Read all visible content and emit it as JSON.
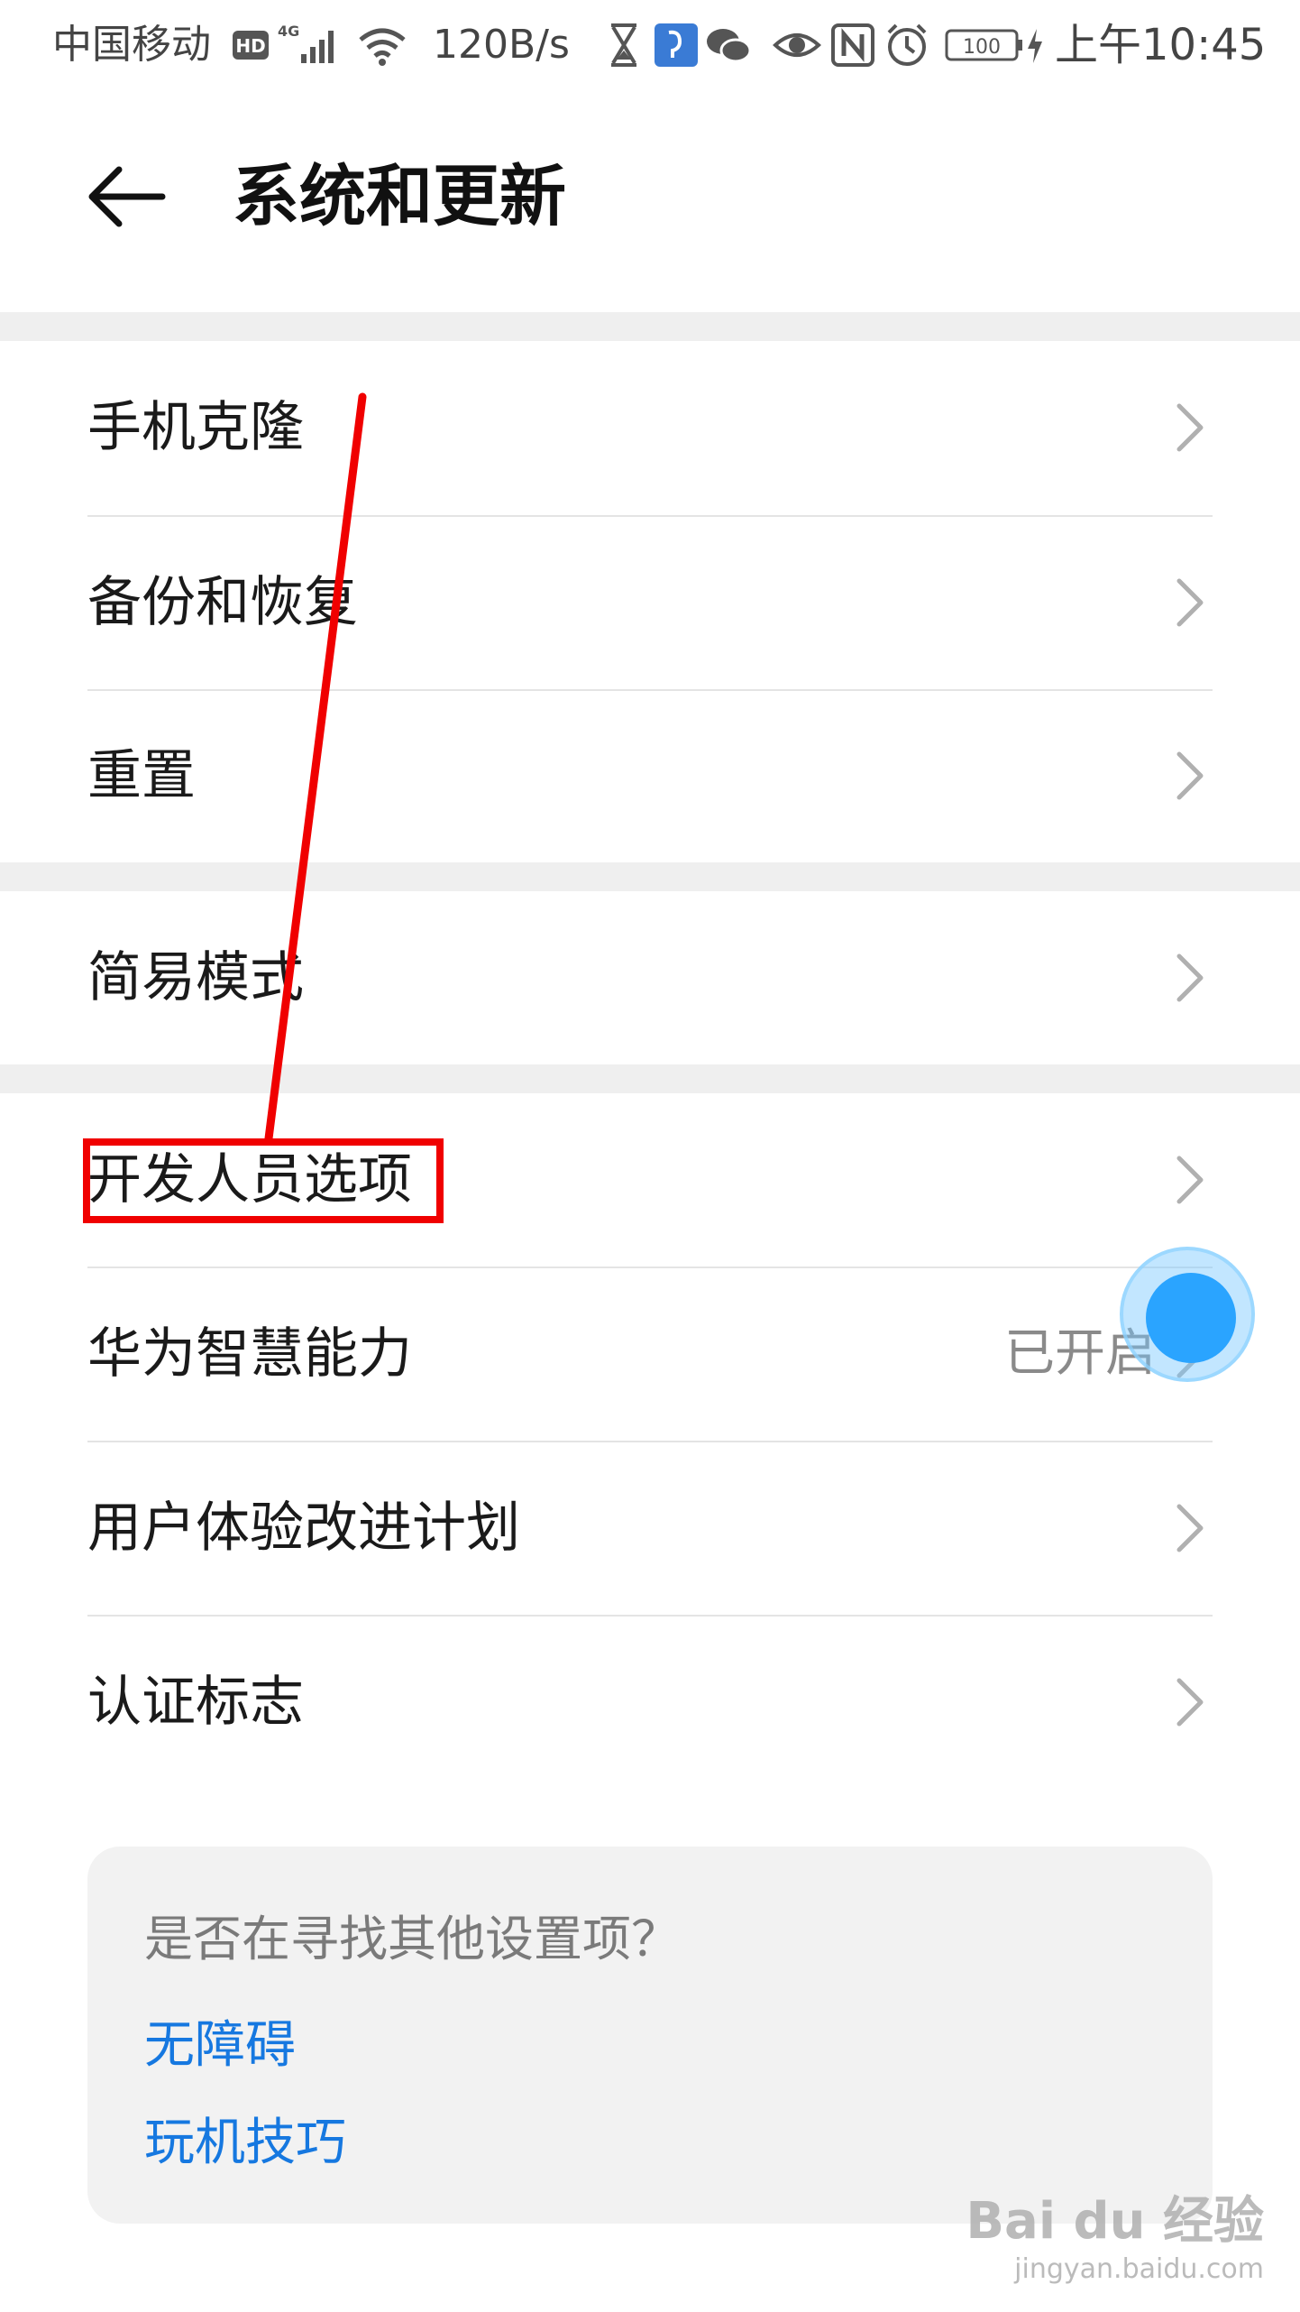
{
  "status_bar": {
    "carrier": "中国移动",
    "network_badges": [
      "HD",
      "4G"
    ],
    "speed": "120B/s",
    "battery": "100",
    "time": "上午10:45",
    "icons": [
      "signal-icon",
      "wifi-icon",
      "hourglass-icon",
      "app-notification-icon",
      "wechat-icon",
      "eye-icon",
      "nfc-icon",
      "alarm-icon",
      "battery-icon",
      "charging-icon"
    ]
  },
  "header": {
    "title": "系统和更新"
  },
  "groups": [
    {
      "items": [
        {
          "label": "手机克隆"
        },
        {
          "label": "备份和恢复"
        },
        {
          "label": "重置"
        }
      ]
    },
    {
      "items": [
        {
          "label": "简易模式"
        }
      ]
    },
    {
      "items": [
        {
          "label": "开发人员选项"
        },
        {
          "label": "华为智慧能力",
          "value": "已开启"
        },
        {
          "label": "用户体验改进计划"
        },
        {
          "label": "认证标志"
        }
      ]
    }
  ],
  "suggestions": {
    "title": "是否在寻找其他设置项？",
    "links": [
      "无障碍",
      "玩机技巧"
    ]
  },
  "watermark": {
    "logo": "Bai du 经验",
    "url": "jingyan.baidu.com"
  },
  "annotation": {
    "color": "#f00000",
    "highlighted_item": "开发人员选项"
  },
  "colors": {
    "link": "#1678e0",
    "group_gap": "#efefef",
    "touch_indicator": "#2aa4ff"
  }
}
